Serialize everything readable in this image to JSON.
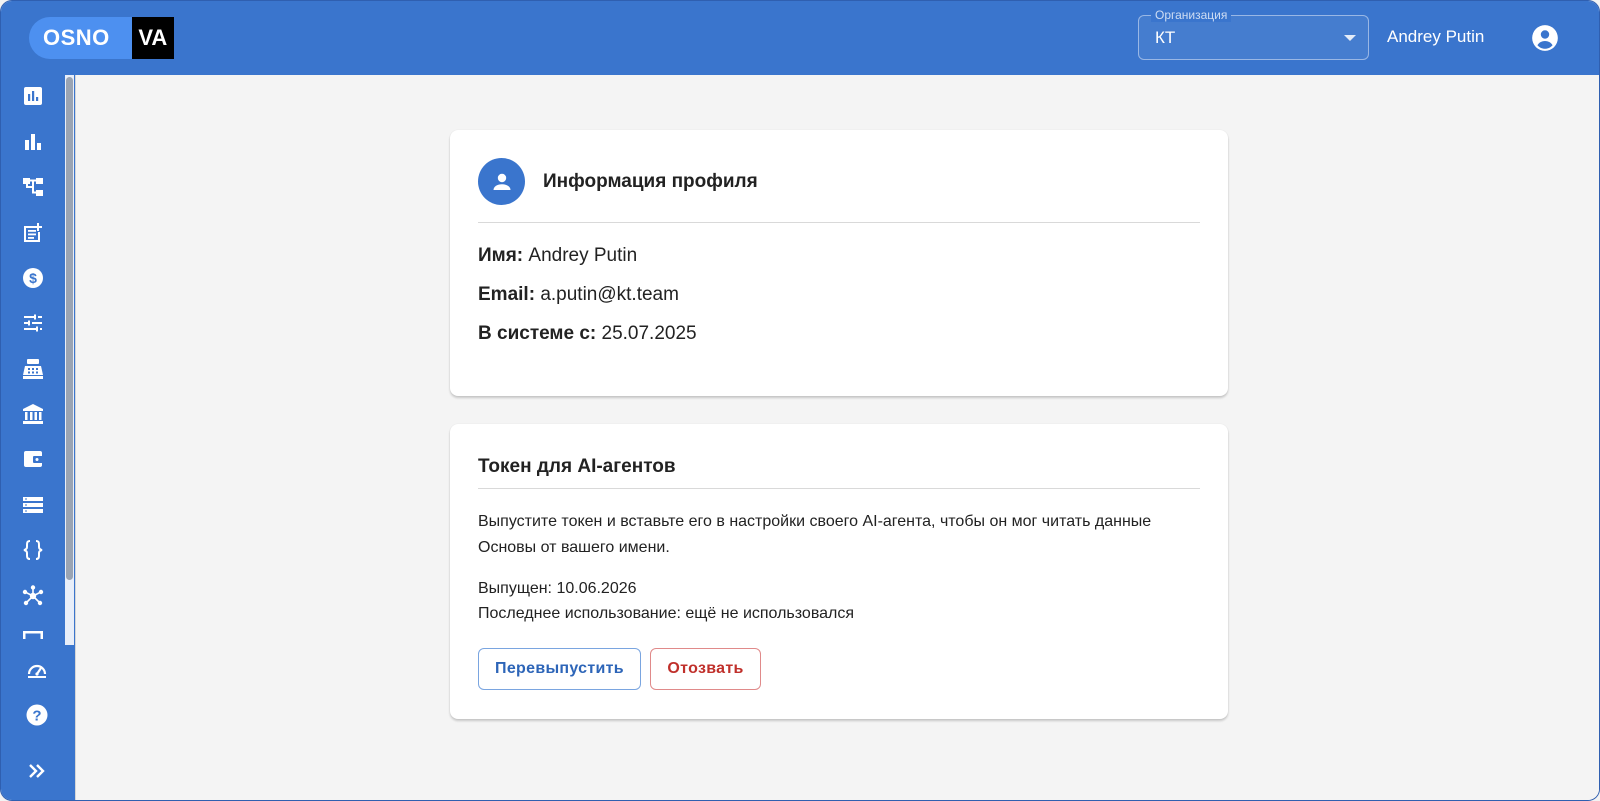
{
  "header": {
    "logo_left": "OSNO",
    "logo_right": "VA",
    "org_label": "Организация",
    "org_value": "КТ",
    "user_name": "Andrey Putin"
  },
  "sidebar": {
    "items": [
      {
        "icon": "assessment-icon"
      },
      {
        "icon": "bar-chart-icon"
      },
      {
        "icon": "account-tree-icon"
      },
      {
        "icon": "post-add-icon"
      },
      {
        "icon": "monetization-icon"
      },
      {
        "icon": "tune-icon"
      },
      {
        "icon": "point-of-sale-icon"
      },
      {
        "icon": "bank-icon"
      },
      {
        "icon": "wallet-icon"
      },
      {
        "icon": "storage-icon"
      },
      {
        "icon": "data-object-icon"
      },
      {
        "icon": "hub-icon"
      },
      {
        "icon": "partial-hidden-icon"
      }
    ],
    "bottom": [
      {
        "icon": "speed-icon"
      },
      {
        "icon": "help-icon"
      },
      {
        "icon": "expand-icon"
      }
    ]
  },
  "profile": {
    "title": "Информация профиля",
    "name_label": "Имя:",
    "name_value": "Andrey Putin",
    "email_label": "Email:",
    "email_value": "a.putin@kt.team",
    "since_label": "В системе с:",
    "since_value": "25.07.2025"
  },
  "token": {
    "title": "Токен для AI-агентов",
    "description_line1": "Выпустите токен и вставьте его в настройки своего AI-агента, чтобы он мог читать данные",
    "description_line2": "Основы от вашего имени.",
    "issued": "Выпущен: 10.06.2026",
    "last_used": "Последнее использование: ещё не использовался",
    "reissue_label": "Перевыпустить",
    "revoke_label": "Отозвать"
  }
}
